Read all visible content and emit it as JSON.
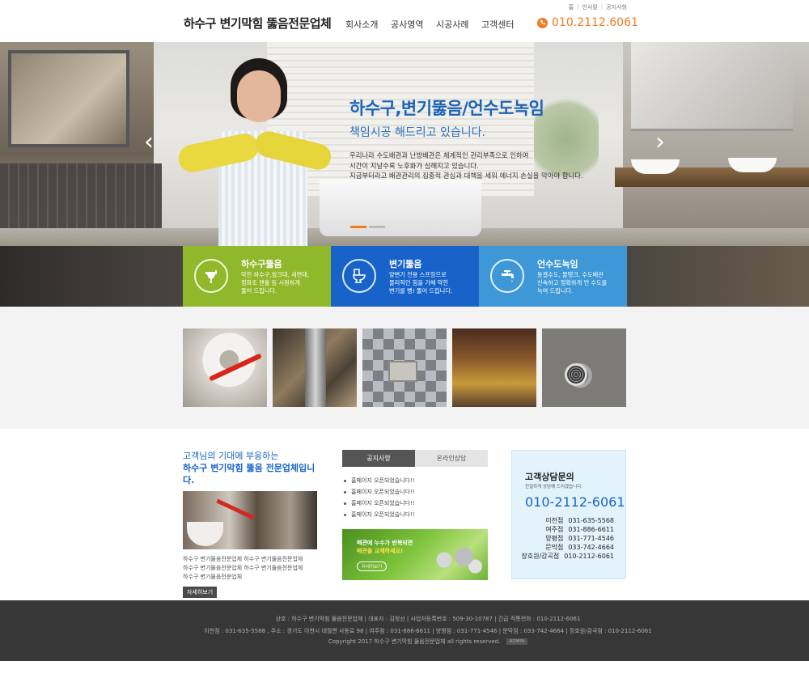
{
  "header": {
    "util_links": [
      "홈",
      "인사말",
      "공지사항"
    ],
    "logo": "하수구 변기막힘 뚫음전문업체",
    "nav": [
      "회사소개",
      "공사영역",
      "시공사례",
      "고객센터"
    ],
    "phone_icon": "phone-icon",
    "phone": "010.2112.6061",
    "accent_color": "#f07c1d"
  },
  "hero": {
    "title": "하수구,변기뚫음/언수도녹임",
    "subtitle": "책임시공 해드리고 있습니다.",
    "description": "우리나라 수도배관과 난방배관은 체계적인 관리부족으로 인하여\n시간이 지날수록 노후화가 심해지고 있습니다.\n지금부터라고 배관관리의 집중적 관심과 대책을 세워 에너지 손실을 막아야 합니다.",
    "prev_icon": "chevron-left-icon",
    "next_icon": "chevron-right-icon",
    "slide_count": 2,
    "active_slide": 1
  },
  "services": [
    {
      "title": "하수구뚫음",
      "desc": "막힌 하수구,씽크대, 세면대,\n정화조 맨홀 등 시원하게\n뚫어 드립니다.",
      "icon": "sink-icon",
      "color": "#8fb82b"
    },
    {
      "title": "변기뚫음",
      "desc": "양변기 전용 스프링으로\n물리적인 힘을 가해 막힌\n변기를 뻥! 뚫어 드립니다.",
      "icon": "toilet-icon",
      "color": "#1763c9"
    },
    {
      "title": "언수도녹임",
      "desc": "동결수도, 물탱크, 수도배관\n신속하고 정확하게 언 수도를\n녹여 드립니다.",
      "icon": "faucet-icon",
      "color": "#3e97d6"
    }
  ],
  "gallery": [
    "toilet-drain-photo",
    "pipe-cleaning-photo",
    "tile-drain-photo",
    "sewer-photo",
    "floor-grate-photo"
  ],
  "intro": {
    "line1": "고객님의 기대에 부응하는",
    "line2": "하수구 변기막힘 뚫음 전문업체입니다.",
    "body": "하수구 변기뚫음전문업체 하수구 변기뚫음전문업체\n하수구 변기뚫음전문업체 하수구 변기뚫음전문업체\n하수구 변기뚫음전문업체",
    "more": "자세히보기"
  },
  "board": {
    "tabs": [
      "공지사항",
      "온라인상담"
    ],
    "active_tab": 0,
    "items": [
      "홈페이지 오픈되었습니다!!",
      "홈페이지 오픈되었습니다!!",
      "홈페이지 오픈되었습니다!!",
      "홈페이지 오픈되었습니다!!"
    ],
    "banner_line1": "배관에 누수가 반복되면",
    "banner_line2": "배관을 교체하세요!",
    "banner_button": "자세히보기"
  },
  "contact": {
    "title": "고객상담문의",
    "subtitle": "친절하게 상담해 드리겠습니다.",
    "main_phone": "010-2112-6061",
    "branches": [
      {
        "name": "이천점",
        "phone": "031-635-5568"
      },
      {
        "name": "여주점",
        "phone": "031-886-6611"
      },
      {
        "name": "양평점",
        "phone": "031-771-4546"
      },
      {
        "name": "문막점",
        "phone": "033-742-4664"
      },
      {
        "name": "장호원/감곡점",
        "phone": "010-2112-6061"
      }
    ]
  },
  "footer": {
    "line1": "상호 : 하수구 변기막힘 뚫음전문업체  |  대표자 : 김정선  |  사업자등록번호 : 509-30-10787  |  긴급 직통전화 : 010-2112-6061",
    "line2": "이천점 : 031-635-5568 , 주소 : 경기도 이천시 대월면 사동로 98  |  여주점 : 031-886-6611  |  양평점 : 031-771-4546  |  문막점 : 033-742-4664  |  장호원/감곡점 : 010-2112-6061",
    "copyright": "Copyright 2017 하수구 변기막힘 뚫음전문업체 all rights reserved.",
    "admin": "ADMIN"
  }
}
